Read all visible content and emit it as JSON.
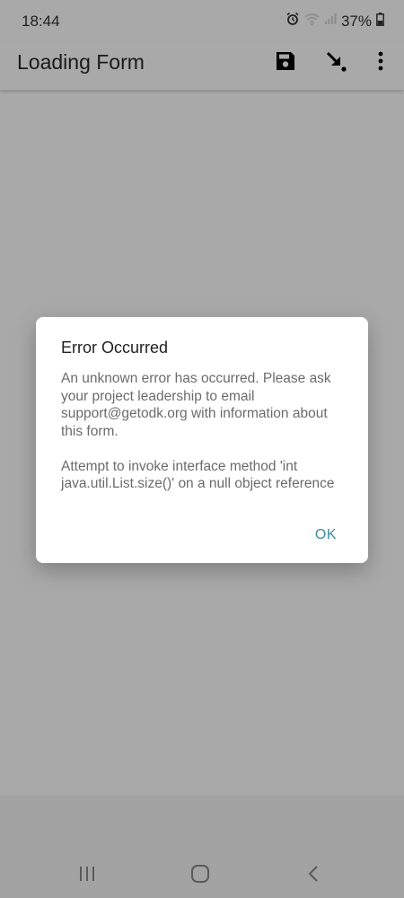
{
  "status_bar": {
    "time": "18:44",
    "battery_percent": "37%",
    "icons": [
      "alarm-icon",
      "wifi-icon",
      "signal-icon",
      "battery-icon"
    ]
  },
  "app_bar": {
    "title": "Loading Form",
    "actions": [
      "save-icon",
      "go-to-end-icon",
      "more-vert-icon"
    ]
  },
  "dialog": {
    "title": "Error Occurred",
    "message_1": "An unknown error has occurred. Please ask your project leadership to email support@getodk.org with information about this form.",
    "message_2": "Attempt to invoke interface method 'int java.util.List.size()' on a null object reference",
    "ok_label": "OK"
  },
  "nav_bar": {
    "buttons": [
      "recent-apps-icon",
      "home-icon",
      "back-icon"
    ]
  },
  "colors": {
    "scrim_background": "#a9a9a9",
    "dialog_background": "#ffffff",
    "accent": "#3a8ca3",
    "body_text": "#6b6b6b"
  }
}
